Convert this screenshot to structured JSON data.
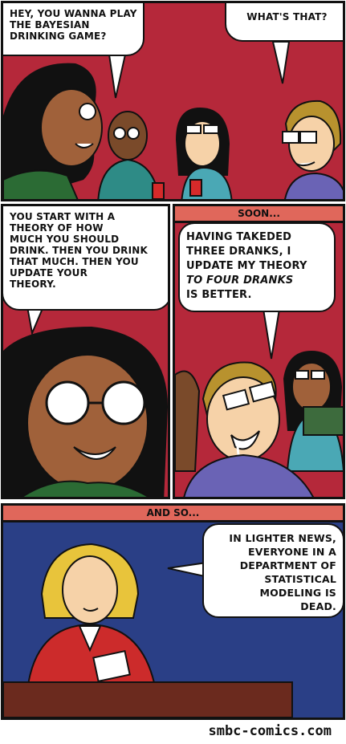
{
  "panel1": {
    "bubble_left": [
      "Hey, you wanna play",
      "the Bayesian",
      "drinking game?"
    ],
    "bubble_right": [
      "What's that?"
    ]
  },
  "panel2": {
    "bubble": [
      "You start with a",
      "theory of how",
      "much you should",
      "drink. Then you drink",
      "that much. Then you",
      "update your",
      "theory."
    ]
  },
  "panel3": {
    "caption": "SOON...",
    "bubble": [
      "Having takeded",
      "three dranks, I",
      "update my theory",
      "to four dranks",
      "is better."
    ]
  },
  "panel4": {
    "caption": "AND SO...",
    "bubble": [
      "In lighter news,",
      "everyone in a",
      "department of",
      "statistical",
      "modeling is",
      "dead."
    ]
  },
  "footer": {
    "credit": "smbc-comics.com"
  },
  "colors": {
    "wall_red": "#b5283a",
    "news_blue": "#2a3f86",
    "caption_red": "#e0675b",
    "skin_dark": "#a0613a",
    "skin_light": "#f6d2a8"
  }
}
